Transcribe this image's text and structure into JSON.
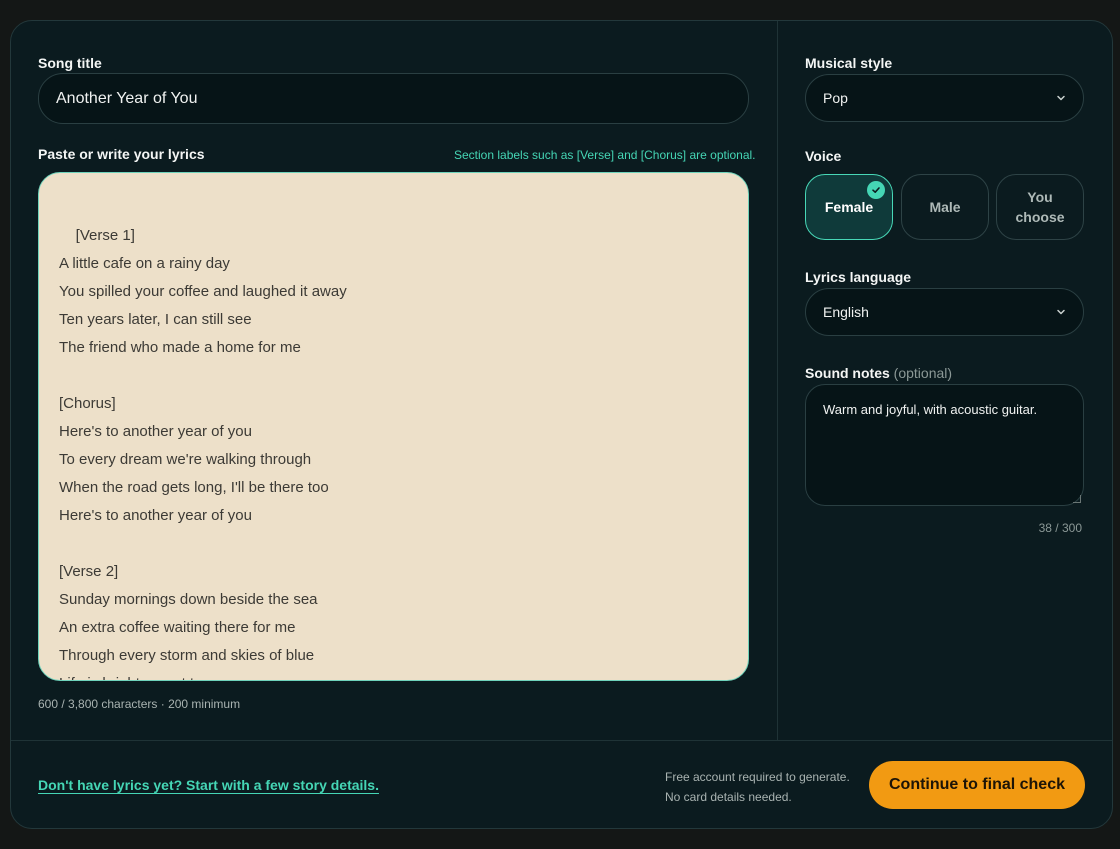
{
  "form": {
    "song_title_label": "Song title",
    "song_title_value": "Another Year of You",
    "lyrics_label": "Paste or write your lyrics",
    "lyrics_hint": "Section labels such as [Verse] and [Chorus] are optional.",
    "lyrics_value": "[Verse 1]\nA little cafe on a rainy day\nYou spilled your coffee and laughed it away\nTen years later, I can still see\nThe friend who made a home for me\n\n[Chorus]\nHere's to another year of you\nTo every dream we're walking through\nWhen the road gets long, I'll be there too\nHere's to another year of you\n\n[Verse 2]\nSunday mornings down beside the sea\nAn extra coffee waiting there for me\nThrough every storm and skies of blue\nLife is brighter next to you",
    "lyrics_counter": "600 / 3,800 characters · 200 minimum"
  },
  "settings": {
    "style_label": "Musical style",
    "style_value": "Pop",
    "voice_label": "Voice",
    "voice_options": [
      {
        "label": "Female",
        "selected": true
      },
      {
        "label": "Male",
        "selected": false
      },
      {
        "label": "You choose",
        "selected": false
      }
    ],
    "language_label": "Lyrics language",
    "language_value": "English",
    "notes_label": "Sound notes",
    "notes_optional": "(optional)",
    "notes_value": "Warm and joyful, with acoustic guitar.",
    "notes_counter": "38 / 300"
  },
  "footer": {
    "story_link": "Don't have lyrics yet? Start with a few story details.",
    "free_note_line1": "Free account required to generate.",
    "free_note_line2": "No card details needed.",
    "cta_label": "Continue to final check"
  },
  "colors": {
    "accent": "#45d6b5",
    "cta": "#f29a12",
    "lyrics_bg": "#ede0c9",
    "card_bg": "#0b1b1f"
  },
  "icons": {
    "select_chevron": "chevron-down-icon",
    "voice_selected": "check-icon"
  }
}
